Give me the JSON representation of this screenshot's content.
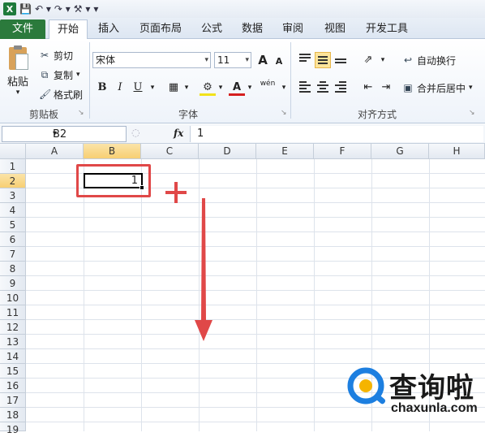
{
  "quick_access": {
    "excel_icon": "X",
    "save_icon": "save-icon",
    "undo_icon": "undo-icon",
    "redo_icon": "redo-icon"
  },
  "tabs": [
    {
      "label": "文件"
    },
    {
      "label": "开始"
    },
    {
      "label": "插入"
    },
    {
      "label": "页面布局"
    },
    {
      "label": "公式"
    },
    {
      "label": "数据"
    },
    {
      "label": "审阅"
    },
    {
      "label": "视图"
    },
    {
      "label": "开发工具"
    }
  ],
  "ribbon": {
    "clipboard": {
      "paste": "粘贴",
      "cut": "剪切",
      "copy": "复制",
      "format_painter": "格式刷",
      "group": "剪贴板"
    },
    "font": {
      "name": "宋体",
      "size": "11",
      "group": "字体",
      "bold": "B",
      "italic": "I",
      "underline": "U",
      "grow": "A",
      "shrink": "A",
      "wen": "wén"
    },
    "alignment": {
      "wrap": "自动换行",
      "merge": "合并后居中",
      "group": "对齐方式"
    }
  },
  "formula_bar": {
    "name_box": "B2",
    "fx": "fx",
    "value": "1"
  },
  "grid": {
    "columns": [
      "A",
      "B",
      "C",
      "D",
      "E",
      "F",
      "G",
      "H"
    ],
    "rows": [
      "1",
      "2",
      "3",
      "4",
      "5",
      "6",
      "7",
      "8",
      "9",
      "10",
      "11",
      "12",
      "13",
      "14",
      "15",
      "16",
      "17",
      "18",
      "19"
    ],
    "selected_cell": {
      "ref": "B2",
      "value": "1"
    }
  },
  "watermark": {
    "title": "查询啦",
    "url": "chaxunla.com"
  },
  "colors": {
    "file_tab": "#2b7a3c",
    "selection_header": "#f7cf73",
    "annotation_red": "#e04848"
  }
}
